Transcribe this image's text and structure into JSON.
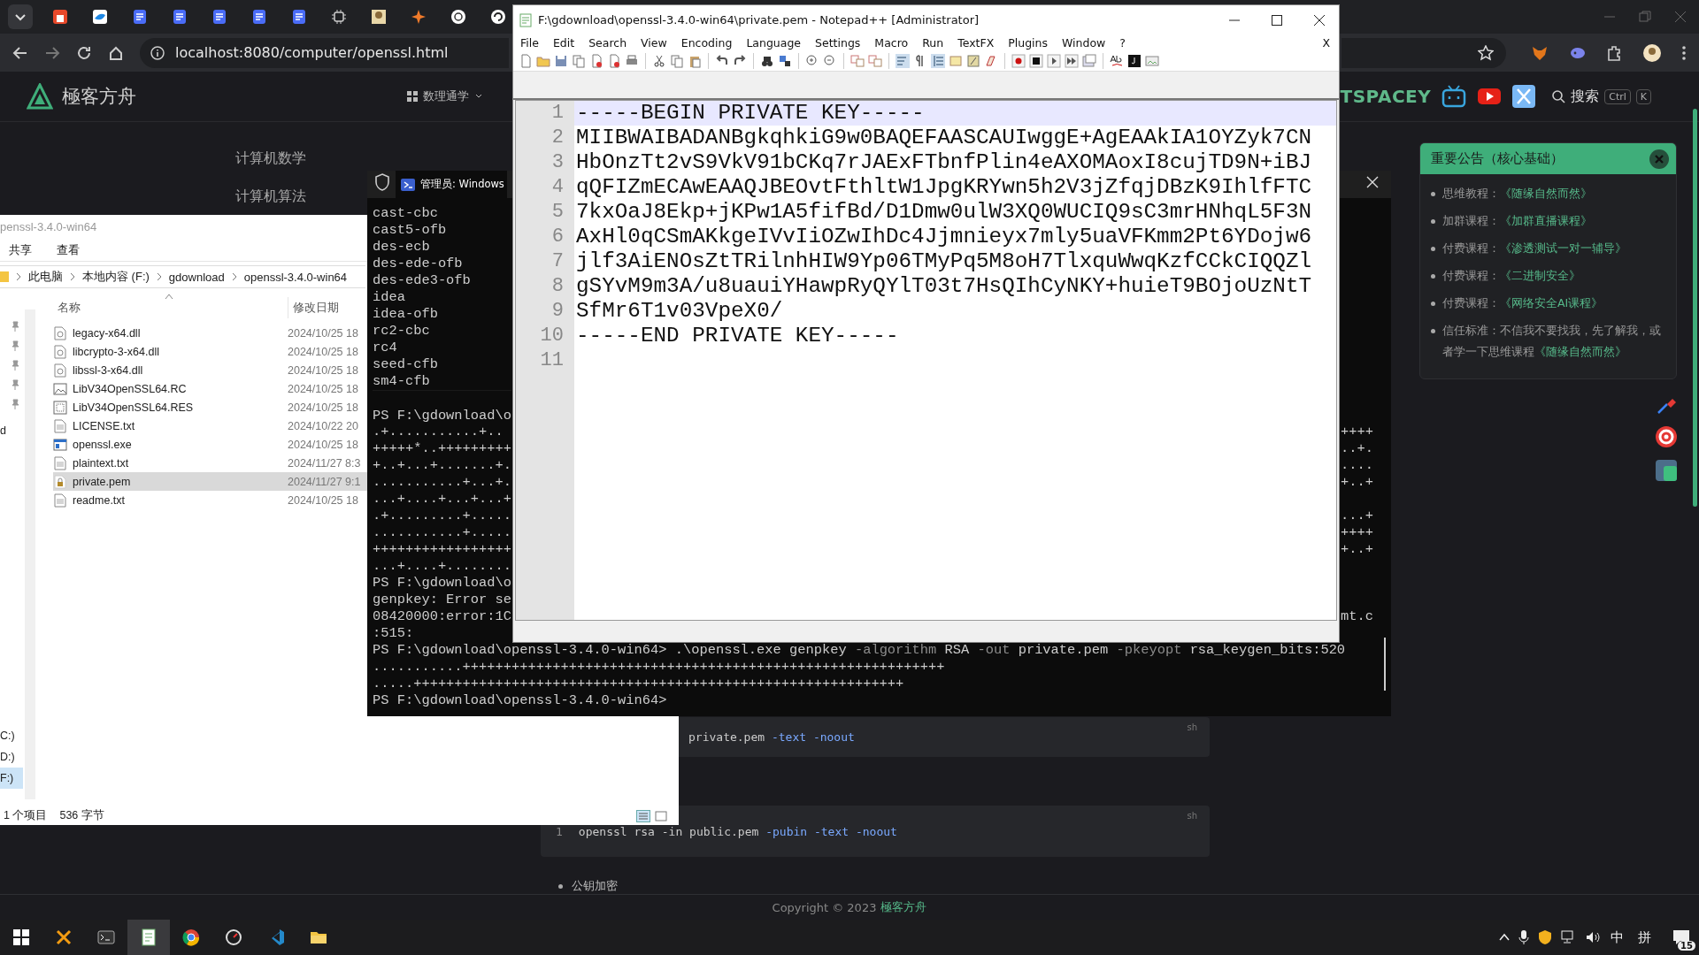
{
  "browser": {
    "url": "localhost:8080/computer/openssl.html"
  },
  "site": {
    "logo": "極客方舟",
    "nav": "数理通学",
    "brand": "TSPACEY",
    "search": "搜索",
    "keys": [
      "Ctrl",
      "K"
    ],
    "side_links": [
      "计算机数学",
      "计算机算法"
    ],
    "notice": {
      "title": "重要公告（核心基础）",
      "items": [
        {
          "label": "思维教程：",
          "link": "《随缘自然而然》"
        },
        {
          "label": "加群课程：",
          "link": "《加群直播课程》"
        },
        {
          "label": "付费课程：",
          "link": "《渗透测试一对一辅导》"
        },
        {
          "label": "付费课程：",
          "link": "《二进制安全》"
        },
        {
          "label": "付费课程：",
          "link": "《网络安全AI课程》"
        },
        {
          "label": "信任标准：不信我不要找我，先了解我，或者学一下思维课程",
          "link": "《随缘自然而然》"
        }
      ]
    },
    "code_blocks": [
      {
        "tokens": [
          {
            "text": "private.pem ",
            "kind": "plain"
          },
          {
            "text": "-text -noout",
            "kind": "flag"
          }
        ],
        "lang": "sh"
      },
      {
        "line_number": "1",
        "tokens": [
          {
            "text": "openssl rsa -in public.pem ",
            "kind": "plain"
          },
          {
            "text": "-pubin -text -noout",
            "kind": "flag"
          }
        ],
        "lang": "sh"
      }
    ],
    "bullet": "公钥加密",
    "footer": {
      "text": "Copyright © 2023",
      "link": "極客方舟"
    }
  },
  "explorer": {
    "title": "penssl-3.4.0-win64",
    "ribbon": [
      "共享",
      "查看"
    ],
    "path": [
      "此电脑",
      "本地内容 (F:)",
      "gdownload",
      "openssl-3.4.0-win64"
    ],
    "columns": [
      "名称",
      "修改日期"
    ],
    "nav_items": [
      {
        "label": "d",
        "selected": false
      },
      {
        "label": "C:)",
        "selected": false
      },
      {
        "label": "D:)",
        "selected": false
      },
      {
        "label": "F:)",
        "selected": true
      }
    ],
    "files": [
      {
        "name": "legacy-x64.dll",
        "modified": "2024/10/25 18",
        "kind": "dll",
        "selected": false
      },
      {
        "name": "libcrypto-3-x64.dll",
        "modified": "2024/10/25 18",
        "kind": "dll",
        "selected": false
      },
      {
        "name": "libssl-3-x64.dll",
        "modified": "2024/10/25 18",
        "kind": "dll",
        "selected": false
      },
      {
        "name": "LibV34OpenSSL64.RC",
        "modified": "2024/10/25 18",
        "kind": "image",
        "selected": false
      },
      {
        "name": "LibV34OpenSSL64.RES",
        "modified": "2024/10/25 18",
        "kind": "resource",
        "selected": false
      },
      {
        "name": "LICENSE.txt",
        "modified": "2024/10/22 20",
        "kind": "text",
        "selected": false
      },
      {
        "name": "openssl.exe",
        "modified": "2024/10/25 18",
        "kind": "exe",
        "selected": false
      },
      {
        "name": "plaintext.txt",
        "modified": "2024/11/27 8:3",
        "kind": "text",
        "selected": false
      },
      {
        "name": "private.pem",
        "modified": "2024/11/27 9:1",
        "kind": "cert",
        "selected": true
      },
      {
        "name": "readme.txt",
        "modified": "2024/10/25 18",
        "kind": "text",
        "selected": false
      }
    ],
    "status": [
      "1 个项目",
      "536 字节"
    ]
  },
  "terminal": {
    "title": "管理员: Windows",
    "lines": [
      {
        "text": "cast-cbc"
      },
      {
        "text": "cast5-ofb"
      },
      {
        "text": "des-ecb"
      },
      {
        "text": "des-ede-ofb"
      },
      {
        "text": "des-ede3-ofb"
      },
      {
        "text": "idea"
      },
      {
        "text": "idea-ofb"
      },
      {
        "text": "rc2-cbc"
      },
      {
        "text": "rc4"
      },
      {
        "text": "seed-cfb"
      },
      {
        "text": "sm4-cfb"
      },
      {
        "text": "PS F:\\gdownload\\o",
        "gap_before": true
      },
      {
        "text": ".+...........+..",
        "tail": "++++"
      },
      {
        "text": "+++++*..+++++++++",
        "tail": "..+."
      },
      {
        "text": "+..+...+.......+.",
        "tail": "...."
      },
      {
        "text": "...........+...+.",
        "tail": "+..+"
      },
      {
        "text": "...+....+...+...+"
      },
      {
        "text": ".+.........+.....",
        "tail": "...+"
      },
      {
        "text": "...........+.....",
        "tail": "++++"
      },
      {
        "text": "+++++++++++++++++",
        "tail": "+..+"
      },
      {
        "text": "...+....+........"
      },
      {
        "text": "PS F:\\gdownload\\o"
      },
      {
        "text": "genpkey: Error se"
      },
      {
        "text": "08420000:error:1C",
        "tail": "mt.c"
      },
      {
        "text": ":515:"
      },
      {
        "segments": [
          {
            "text": "PS F:\\gdownload\\openssl-3.4.0-win64> .\\openssl.exe genpkey ",
            "kind": "plain"
          },
          {
            "text": "-algorithm",
            "kind": "flag"
          },
          {
            "text": " RSA ",
            "kind": "plain"
          },
          {
            "text": "-out",
            "kind": "flag"
          },
          {
            "text": " private.pem ",
            "kind": "plain"
          },
          {
            "text": "-pkeyopt",
            "kind": "flag"
          },
          {
            "text": " rsa_keygen_bits:520",
            "kind": "plain"
          }
        ]
      },
      {
        "text": "...........+++++++++++++++++++++++++++++++++++++++++++++++++++++++++++"
      },
      {
        "text": ".....++++++++++++++++++++++++++++++++++++++++++++++++++++++++++++"
      },
      {
        "text": "PS F:\\gdownload\\openssl-3.4.0-win64>"
      }
    ]
  },
  "notepad": {
    "title": "F:\\gdownload\\openssl-3.4.0-win64\\private.pem - Notepad++ [Administrator]",
    "menu": [
      "File",
      "Edit",
      "Search",
      "View",
      "Encoding",
      "Language",
      "Settings",
      "Macro",
      "Run",
      "TextFX",
      "Plugins",
      "Window",
      "?"
    ],
    "close_doc": "X",
    "lines": [
      {
        "number": "1",
        "text": "-----BEGIN PRIVATE KEY-----",
        "current": true
      },
      {
        "number": "2",
        "text": "MIIBWAIBADANBgkqhkiG9w0BAQEFAASCAUIwggE+AgEAAkIA1OYZyk7CN",
        "current": false
      },
      {
        "number": "3",
        "text": "HbOnzTt2vS9VkV91bCKq7rJAExFTbnfPlin4eAXOMAoxI8cujTD9N+iBJ",
        "current": false
      },
      {
        "number": "4",
        "text": "qQFIZmECAwEAAQJBEOvtFthltW1JpgKRYwn5h2V3jZfqjDBzK9IhlfFTC",
        "current": false
      },
      {
        "number": "5",
        "text": "7kxOaJ8Ekp+jKPw1A5fifBd/D1Dmw0ulW3XQ0WUCIQ9sC3mrHNhqL5F3N",
        "current": false
      },
      {
        "number": "6",
        "text": "AxHl0qCSmAKkgeIVvIiOZwIhDc4Jjmnieyx7mly5uaVFKmm2Pt6YDojw6",
        "current": false
      },
      {
        "number": "7",
        "text": "jlf3AiENOsZtTRilnhHIW9Yp06TMyPq5M8oH7TlxquWwqKzfCCkCIQQZl",
        "current": false
      },
      {
        "number": "8",
        "text": "gSYvM9m3A/u8uauiYHawpRyQYlT03t7HsQIhCyNKY+huieT9BOjoUzNtT",
        "current": false
      },
      {
        "number": "9",
        "text": "SfMr6T1v03VpeX0/",
        "current": false
      },
      {
        "number": "10",
        "text": "-----END PRIVATE KEY-----",
        "current": false
      },
      {
        "number": "11",
        "current": false
      }
    ]
  },
  "taskbar": {
    "ime": "中",
    "ime_mode": "拼",
    "notifications": "15"
  }
}
